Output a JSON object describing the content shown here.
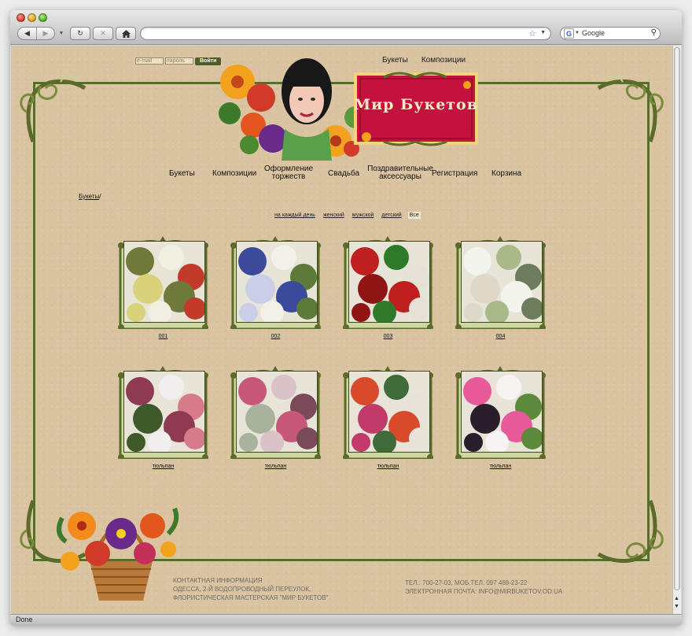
{
  "browser": {
    "search_placeholder": "Google",
    "status": "Done"
  },
  "login": {
    "email_placeholder": "e-mail",
    "password_placeholder": "пароль",
    "button": "Войти"
  },
  "top_links": [
    "Букеты",
    "Композиции"
  ],
  "logo_text": "Мир Букетов",
  "main_nav": [
    "Букеты",
    "Композиции",
    "Оформление торжеств",
    "Свадьба",
    "Поздравительные аксессуары",
    "Регистрация",
    "Корзина"
  ],
  "breadcrumb": {
    "link": "Букеты",
    "separator": "/"
  },
  "filters": {
    "items": [
      "на каждый день",
      "женский",
      "мужской",
      "детский",
      "Все"
    ],
    "active": "Все"
  },
  "products": [
    {
      "caption": "001",
      "palette": [
        "#6f7a3a",
        "#f0efe2",
        "#c23a2a",
        "#d9d27a"
      ]
    },
    {
      "caption": "002",
      "palette": [
        "#3b4a9a",
        "#f1f1ea",
        "#5d7a3a",
        "#c9cfe6"
      ]
    },
    {
      "caption": "003",
      "palette": [
        "#c01f1f",
        "#2f7a2a",
        "#e6e1d6",
        "#8f1515"
      ]
    },
    {
      "caption": "004",
      "palette": [
        "#f4f4ee",
        "#a9b98a",
        "#6d7c5a",
        "#ddd8c8"
      ]
    },
    {
      "caption": "тюльпан",
      "palette": [
        "#8e3a52",
        "#f1eef0",
        "#d77b8a",
        "#3e5a2a"
      ]
    },
    {
      "caption": "тюльпан",
      "palette": [
        "#c7587a",
        "#d9c3c8",
        "#7a4a5a",
        "#a9b29a"
      ]
    },
    {
      "caption": "тюльпан",
      "palette": [
        "#d94a2a",
        "#3f6b3a",
        "#e8e3d8",
        "#c23a6a"
      ]
    },
    {
      "caption": "тюльпан",
      "palette": [
        "#e85a9a",
        "#f7f3f3",
        "#5a8a3a",
        "#2a1e2a"
      ]
    }
  ],
  "footer": {
    "left": [
      "КОНТАКТНАЯ ИНФОРМАЦИЯ",
      "ОДЕССА, 2-Й ВОДОПРОВОДНЫЙ ПЕРЕУЛОК,",
      "ФЛОРИСТИЧЕСКАЯ МАСТЕРСКАЯ \"МИР БУКЕТОВ\""
    ],
    "right": [
      "ТЕЛ.: 700-27-03, МОБ.ТЕЛ. 097 488-23-22",
      "ЭЛЕКТРОННАЯ ПОЧТА: INFO@MIRBUKETOV.OD.UA"
    ]
  },
  "colors": {
    "page_bg": "#d9c3a0",
    "frame_green": "#5a6b2a",
    "logo_red": "#c4123f"
  }
}
